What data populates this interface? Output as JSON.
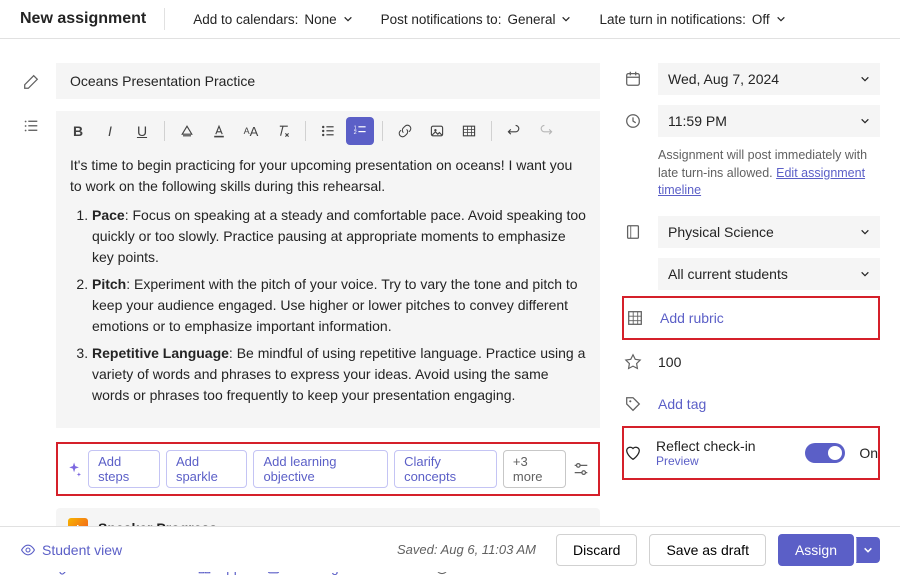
{
  "header": {
    "title": "New assignment",
    "calendars_label": "Add to calendars:",
    "calendars_value": "None",
    "notifications_label": "Post notifications to:",
    "notifications_value": "General",
    "late_label": "Late turn in notifications:",
    "late_value": "Off"
  },
  "editor": {
    "title_value": "Oceans Presentation Practice",
    "intro": "It's time to begin practicing for your upcoming presentation on oceans! I want you to work on the following skills during this rehearsal.",
    "items": [
      {
        "bold": "Pace",
        "rest": ": Focus on speaking at a steady and comfortable pace. Avoid speaking too quickly or too slowly. Practice pausing at appropriate moments to emphasize key points."
      },
      {
        "bold": "Pitch",
        "rest": ": Experiment with the pitch of your voice. Try to vary the tone and pitch to keep your audience engaged. Use higher or lower pitches to convey different emotions or to emphasize important information."
      },
      {
        "bold": "Repetitive Language",
        "rest": ": Be mindful of using repetitive language. Practice using a variety of words and phrases to express your ideas. Avoid using the same words or phrases too frequently to keep your presentation engaging."
      }
    ]
  },
  "ai": {
    "pills": [
      "Add steps",
      "Add sparkle",
      "Add learning objective",
      "Clarify concepts"
    ],
    "more": "+3 more"
  },
  "speaker_card": {
    "title": "Speaker Progress"
  },
  "attach": {
    "attach": "Attach",
    "new": "New",
    "apps": "Apps",
    "accel": "Learning Accelerators",
    "limits": "File limits"
  },
  "sidebar": {
    "date": "Wed, Aug 7, 2024",
    "time": "11:59 PM",
    "hint_pre": "Assignment will post immediately with late turn-ins allowed. ",
    "hint_link": "Edit assignment timeline",
    "class": "Physical Science",
    "assignees": "All current students",
    "add_rubric": "Add rubric",
    "points": "100",
    "add_tag": "Add tag",
    "reflect_label": "Reflect check-in",
    "reflect_preview": "Preview",
    "reflect_state": "On"
  },
  "footer": {
    "student_view": "Student view",
    "saved": "Saved: Aug 6, 11:03 AM",
    "discard": "Discard",
    "save_draft": "Save as draft",
    "assign": "Assign"
  }
}
